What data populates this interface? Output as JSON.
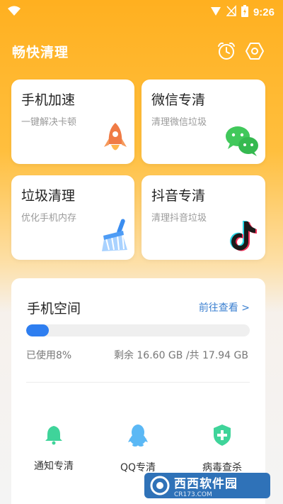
{
  "status": {
    "time": "9:26"
  },
  "header": {
    "title": "畅快清理"
  },
  "cards": [
    {
      "title": "手机加速",
      "subtitle": "一键解决卡顿"
    },
    {
      "title": "微信专清",
      "subtitle": "清理微信垃圾"
    },
    {
      "title": "垃圾清理",
      "subtitle": "优化手机内存"
    },
    {
      "title": "抖音专清",
      "subtitle": "清理抖音垃圾"
    }
  ],
  "storage": {
    "title": "手机空间",
    "link": "前往查看 >",
    "used_label": "已使用8%",
    "used_fraction": 0.08,
    "remaining_label": "剩余 16.60 GB /共 17.94 GB"
  },
  "tools": [
    {
      "label": "通知专清",
      "icon": "bell-icon"
    },
    {
      "label": "QQ专清",
      "icon": "qq-penguin-icon"
    },
    {
      "label": "病毒查杀",
      "icon": "shield-icon"
    }
  ],
  "watermark": {
    "text": "西西软件园",
    "url": "CR173.COM"
  },
  "colors": {
    "accent": "#ffb020",
    "link": "#3a7fd0",
    "progress": "#2e7ef0"
  }
}
